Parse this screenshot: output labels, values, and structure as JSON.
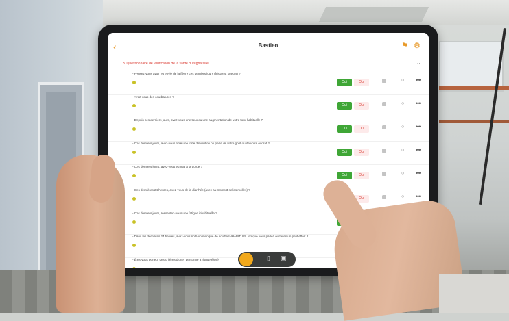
{
  "app": {
    "title": "Bastien",
    "section": "3. Questionnaire de vérification de la santé du signataire"
  },
  "icons": {
    "back": "chevron-left-icon",
    "flag": "flag-icon",
    "settings": "gear-icon",
    "camera": "camera-icon",
    "comment": "comment-icon",
    "more": "more-icon"
  },
  "colors": {
    "accent": "#e89a2a",
    "yes": "#3fa636",
    "no": "#d9382f",
    "section": "#d9382f"
  },
  "labels": {
    "yes": "Oui",
    "no": "Oui"
  },
  "questions": [
    {
      "text": "- Pensez-vous avoir eu envie de la fièvre ces derniers jours (frissons, sueurs) ?"
    },
    {
      "text": "- Avez-vous des courbatures ?"
    },
    {
      "text": "- Depuis ces derniers jours, avez-vous une toux ou une augmentation de votre toux habituelle ?"
    },
    {
      "text": "- Ces derniers jours, avez-vous noté une forte diminution ou perte de votre goût ou de votre odorat ?"
    },
    {
      "text": "- Ces derniers jours, avez-vous eu mal à la gorge ?"
    },
    {
      "text": "- Ces dernières 24 heures, avez-vous de la diarrhée (avec au moins 3 selles molles) ?"
    },
    {
      "text": "- Ces derniers jours, ressentez-vous une fatigue inhabituelle ?"
    },
    {
      "text": "- Dans les dernières 24 heures, avez-vous noté un manque de souffle INHABITUEL lorsque vous parlez ou faites un petit effort ?"
    },
    {
      "text": "- Êtes-vous porteur des critères d'une \"personne à risque élevé\""
    }
  ]
}
